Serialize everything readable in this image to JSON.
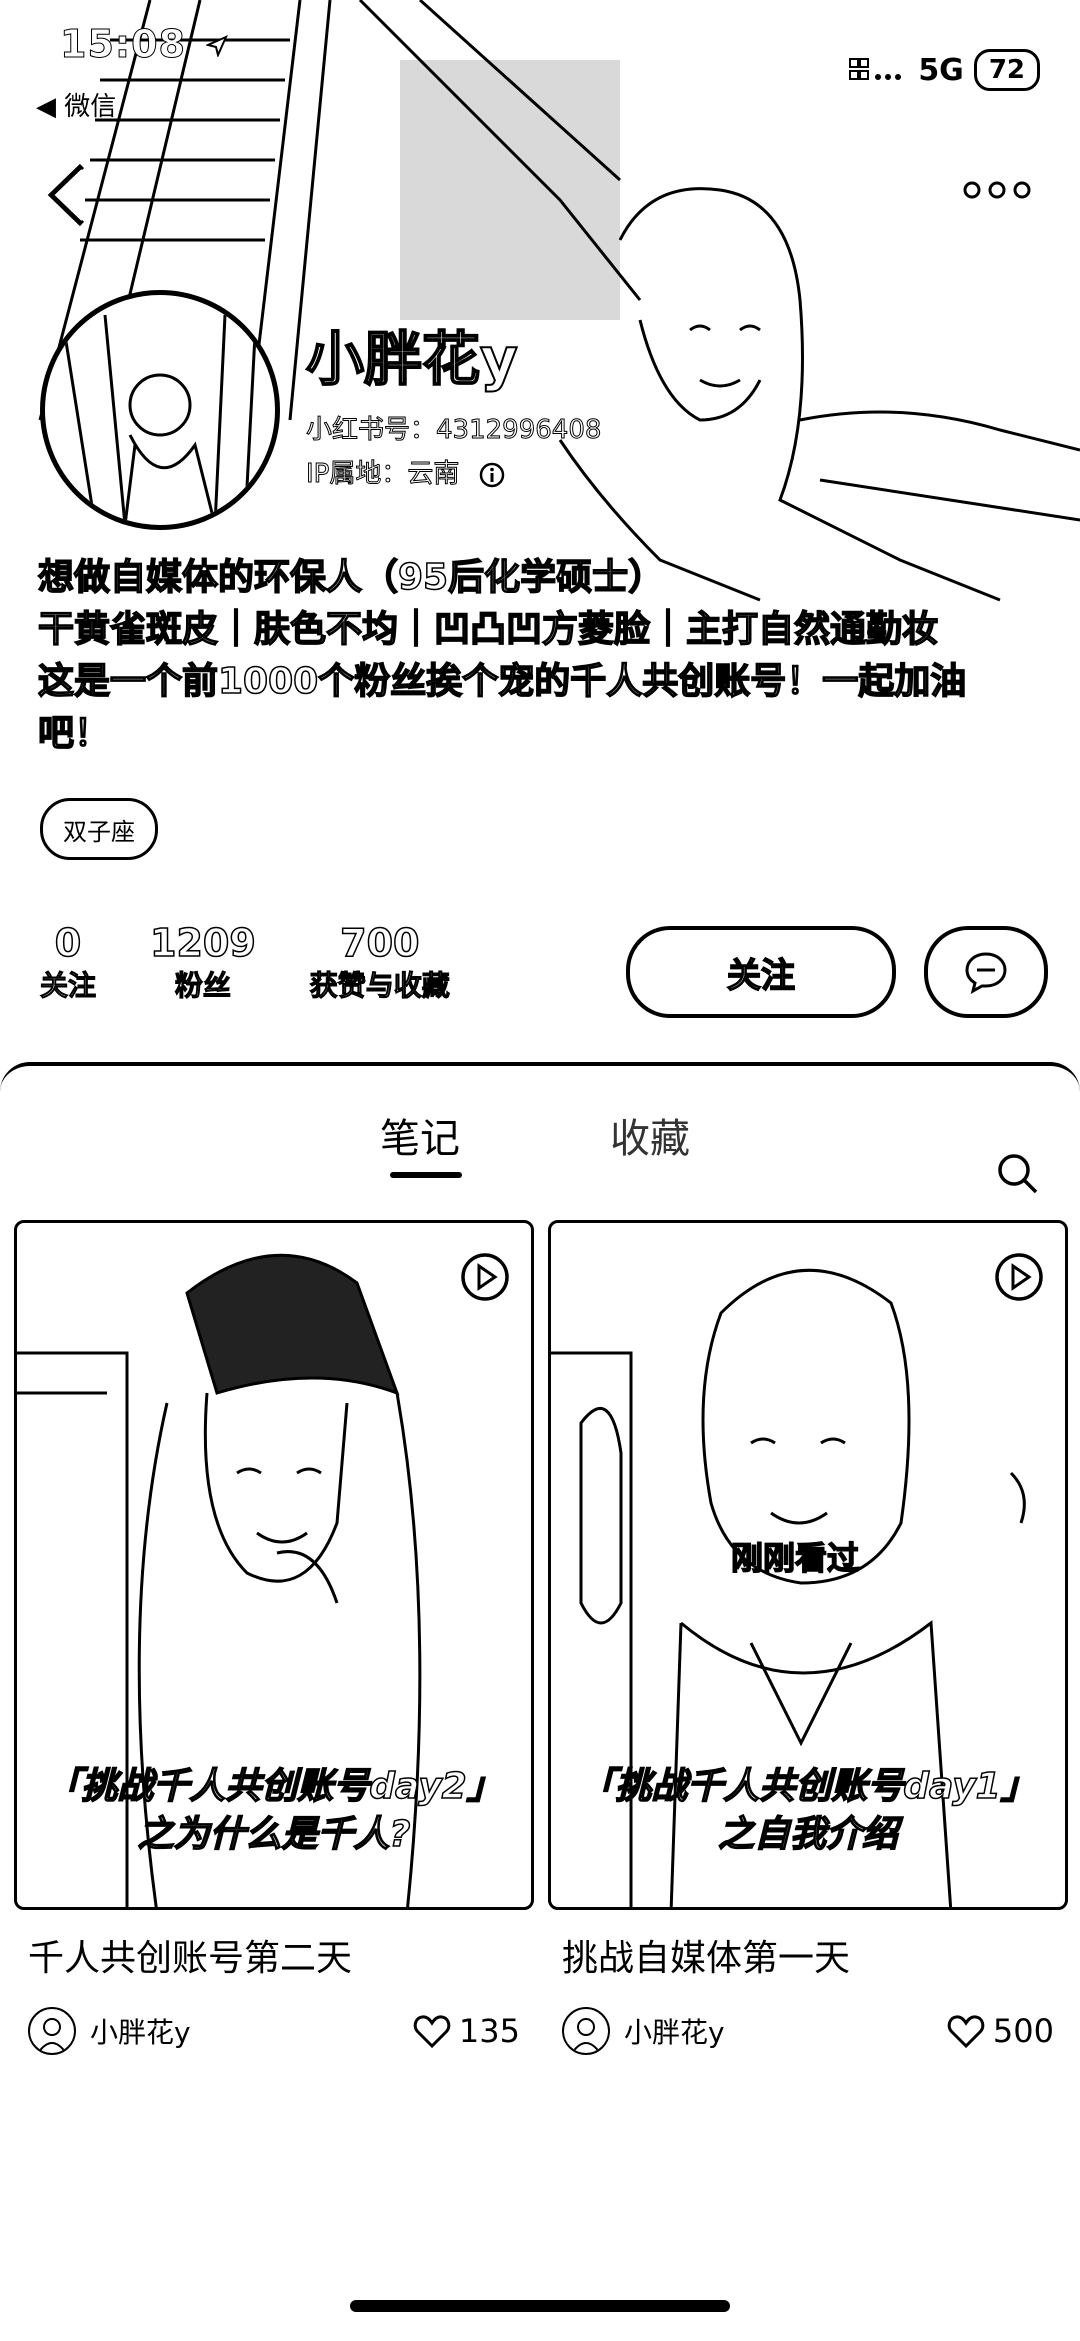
{
  "status_bar": {
    "time": "15:08",
    "back_app": "微信",
    "network": "5G",
    "battery": "72"
  },
  "profile": {
    "name": "小胖花y",
    "account_id": "小红书号：4312996408",
    "ip_location": "IP属地：云南",
    "bio_lines": [
      "想做自媒体的环保人（95后化学硕士）",
      "干黄雀斑皮｜肤色不均｜凹凸凹方菱脸｜主打自然通勤妆",
      "这是一个前1000个粉丝挨个宠的千人共创账号！一起加油吧！"
    ],
    "tag": "双子座"
  },
  "stats": [
    {
      "value": "0",
      "label": "关注"
    },
    {
      "value": "1209",
      "label": "粉丝"
    },
    {
      "value": "700",
      "label": "获赞与收藏"
    }
  ],
  "actions": {
    "follow_label": "关注"
  },
  "tabs": [
    {
      "label": "笔记",
      "active": true
    },
    {
      "label": "收藏",
      "active": false
    }
  ],
  "notes": [
    {
      "overlay_line1": "「挑战千人共创账号day2」",
      "overlay_line2": "之为什么是千人?",
      "title": "千人共创账号第二天",
      "author": "小胖花y",
      "likes": "135",
      "icon": "play-icon"
    },
    {
      "badge": "刚刚看过",
      "overlay_line1": "「挑战千人共创账号day1」",
      "overlay_line2": "之自我介绍",
      "title": "挑战自媒体第一天",
      "author": "小胖花y",
      "likes": "500",
      "icon": "play-icon"
    }
  ]
}
